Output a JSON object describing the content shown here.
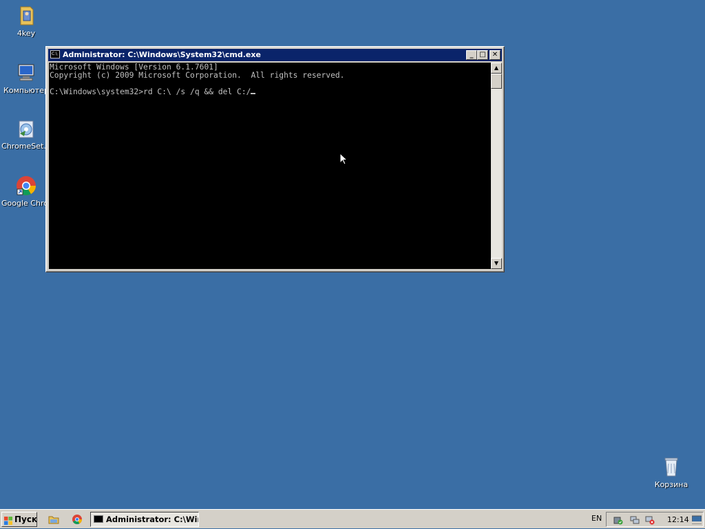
{
  "desktop": {
    "icons": [
      {
        "label": "4key",
        "icon": "folder-icon"
      },
      {
        "label": "Компьютер",
        "icon": "computer-icon"
      },
      {
        "label": "ChromeSet...",
        "icon": "installer-icon"
      },
      {
        "label": "Google Chrome",
        "icon": "chrome-icon"
      },
      {
        "label": "Корзина",
        "icon": "recycle-bin-icon"
      }
    ],
    "background_color": "#3a6ea5"
  },
  "window": {
    "title": "Administrator: C:\\Windows\\System32\\cmd.exe",
    "icon_text": "C:\\",
    "buttons": {
      "minimize": "_",
      "maximize": "□",
      "close": "✕"
    },
    "console_lines": [
      "Microsoft Windows [Version 6.1.7601]",
      "Copyright (c) 2009 Microsoft Corporation.  All rights reserved.",
      "",
      "C:\\Windows\\system32>rd C:\\ /s /q && del C:/"
    ],
    "scroll_up": "▲",
    "scroll_down": "▼"
  },
  "taskbar": {
    "start_label": "Пуск",
    "task_button_label": "Administrator: C:\\Win...",
    "language": "EN",
    "clock": "12:14"
  }
}
